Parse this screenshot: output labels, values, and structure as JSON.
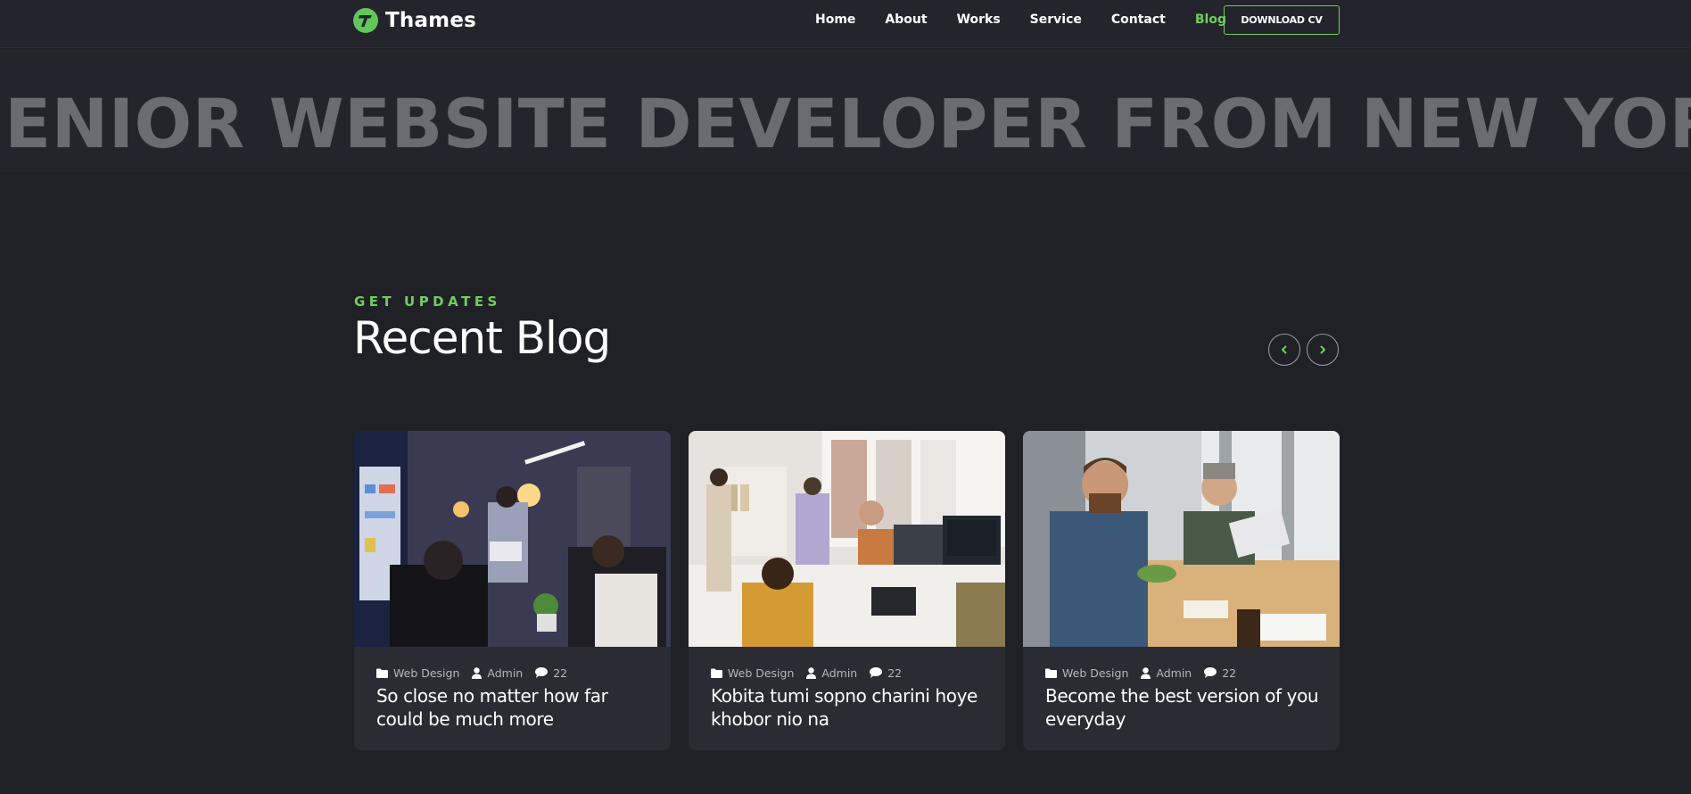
{
  "header": {
    "brand_name": "Thames",
    "nav": [
      "Home",
      "About",
      "Works",
      "Service",
      "Contact",
      "Blog"
    ],
    "active_nav": "Blog",
    "cv_button": "DOWNLOAD CV"
  },
  "marquee": {
    "text": "SENIOR WEBSITE DEVELOPER FROM NEW YORK *  SENIOR WEBSITE DEVELOPER"
  },
  "section": {
    "eyebrow": "GET UPDATES",
    "title": "Recent Blog"
  },
  "posts": [
    {
      "category": "Web Design",
      "author": "Admin",
      "comments": "22",
      "title": "So close no matter how far could be much more"
    },
    {
      "category": "Web Design",
      "author": "Admin",
      "comments": "22",
      "title": "Kobita tumi sopno charini hoye khobor nio na"
    },
    {
      "category": "Web Design",
      "author": "Admin",
      "comments": "22",
      "title": "Become the best version of you everyday"
    }
  ],
  "icons": {
    "logo": "thames-logo-icon",
    "prev": "chevron-left-icon",
    "next": "chevron-right-icon",
    "category": "folder-icon",
    "author": "user-icon",
    "comments": "comment-icon"
  },
  "colors": {
    "accent": "#6fce5e",
    "background": "#202127",
    "card": "#2b2c33",
    "marquee_text": "#6b6c71"
  }
}
